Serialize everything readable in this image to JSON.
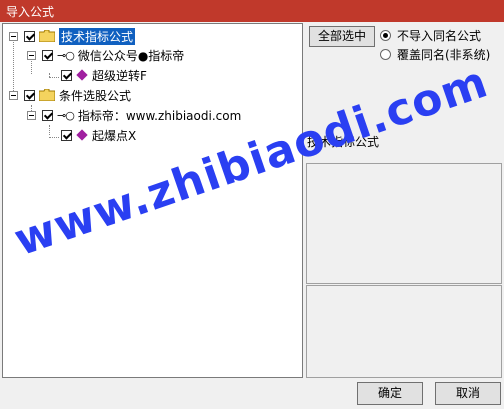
{
  "window": {
    "title": "导入公式"
  },
  "tree": {
    "groups": [
      {
        "label": "技术指标公式",
        "checked": true,
        "selected": true,
        "children": [
          {
            "label": "微信公众号●指标帝",
            "checked": true,
            "items": [
              {
                "label": "超级逆转F",
                "checked": true
              }
            ]
          }
        ]
      },
      {
        "label": "条件选股公式",
        "checked": true,
        "selected": false,
        "children": [
          {
            "label": "指标帝：www.zhibiaodi.com",
            "checked": true,
            "items": [
              {
                "label": "起爆点X",
                "checked": true
              }
            ]
          }
        ]
      }
    ]
  },
  "options": {
    "select_all_label": "全部选中",
    "radio_no_import": "不导入同名公式",
    "radio_overwrite": "覆盖同名(非系统)",
    "selected": "no_import"
  },
  "info": {
    "category_label": "技术指标公式"
  },
  "buttons": {
    "ok": "确定",
    "cancel": "取消"
  },
  "watermark": {
    "text": "www.zhibiaodi.com",
    "color": "#2a3ff2"
  },
  "colors": {
    "title_bar": "#c0392b",
    "selection": "#1060c0",
    "formula_icon": "#a020a0"
  }
}
